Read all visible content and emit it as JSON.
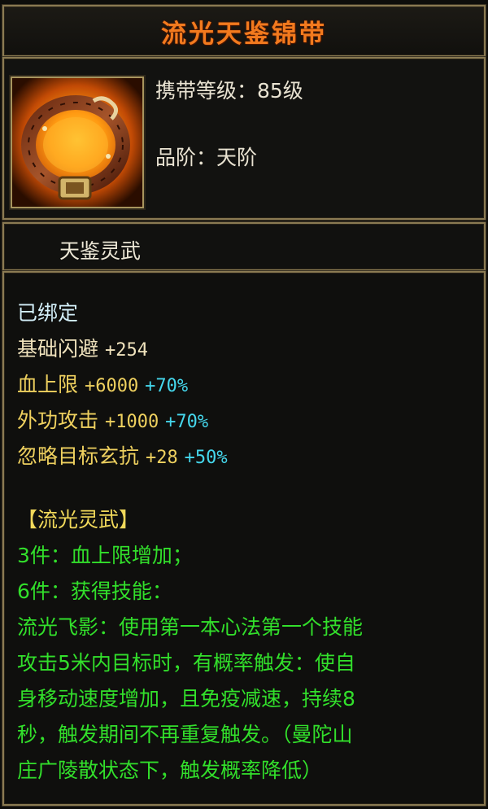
{
  "item": {
    "name": "流光天鉴锦带",
    "required_level": "携带等级：85级",
    "grade": "品阶：天阶",
    "set_title": "天鉴灵武",
    "icon": "belt-icon"
  },
  "attributes": {
    "bound": "已绑定",
    "base": {
      "label": "基础闪避",
      "value": "+254"
    },
    "bonus": [
      {
        "label": "血上限",
        "value": "+6000",
        "pct": "+70%"
      },
      {
        "label": "外功攻击",
        "value": "+1000",
        "pct": "+70%"
      },
      {
        "label": "忽略目标玄抗",
        "value": "+28",
        "pct": "+50%"
      }
    ]
  },
  "set": {
    "header": "【流光灵武】",
    "effects": [
      "3件：血上限增加；",
      "6件：获得技能：",
      "流光飞影：使用第一本心法第一个技能",
      "攻击5米内目标时，有概率触发：使自",
      "身移动速度增加，且免疫减速，持续8",
      "秒，触发期间不再重复触发。（曼陀山",
      "庄广陵散状态下，触发概率降低）"
    ]
  },
  "colors": {
    "title": "#f27a1e",
    "text": "#e9e3d2",
    "gold": "#efd15f",
    "cyan": "#45d7ec",
    "green": "#32df2b"
  }
}
